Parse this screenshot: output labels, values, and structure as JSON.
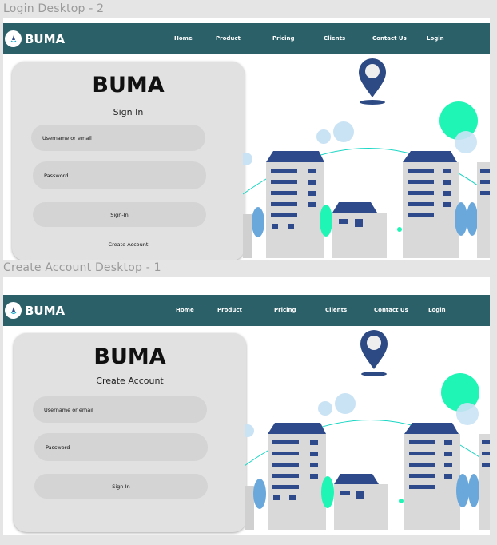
{
  "frames": [
    {
      "label": "Login Desktop - 2",
      "nav": {
        "brand": "BUMA",
        "items": [
          "Home",
          "Product",
          "Pricing",
          "Clients",
          "Contact Us",
          "Login"
        ]
      },
      "card": {
        "title": "BUMA",
        "subtitle": "Sign In",
        "username_placeholder": "Username or email",
        "password_placeholder": "Password",
        "button_label": "Sign-In",
        "link_label": "Create Account"
      }
    },
    {
      "label": "Create Account Desktop - 1",
      "nav": {
        "brand": "BUMA",
        "items": [
          "Home",
          "Product",
          "Pricing",
          "Clients",
          "Contact Us",
          "Login"
        ]
      },
      "card": {
        "title": "BUMA",
        "subtitle": "Create Account",
        "username_placeholder": "Username or email",
        "password_placeholder": "Password",
        "button_label": "Sign-In"
      }
    }
  ],
  "colors": {
    "nav_bg": "#2c6069",
    "card_bg": "#e1e1e1",
    "field_bg": "#d4d4d4",
    "pin": "#2d4a84",
    "building": "#2f4a8a",
    "arc": "#18d6c4",
    "accent_green": "#1ff5b5"
  }
}
